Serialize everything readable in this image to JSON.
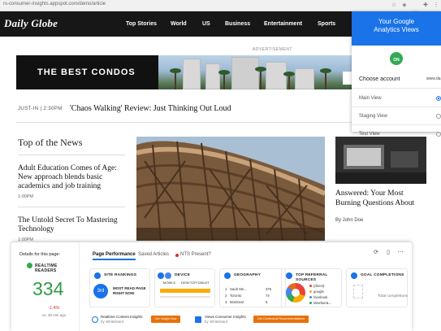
{
  "browser": {
    "url": "rs-consumer-insights.appspot.com/demo/article",
    "icons": [
      "star-icon",
      "extension-icon",
      "analytics-extension-icon",
      "puzzle-icon",
      "menu-icon"
    ]
  },
  "site": {
    "logo": "Daily Globe",
    "nav": [
      "Top Stories",
      "World",
      "US",
      "Business",
      "Entertainment",
      "Sports"
    ]
  },
  "ad": {
    "label": "ADVERTISEMENT",
    "title": "THE BEST CONDOS",
    "cta": "LEAS"
  },
  "ticker": {
    "label": "JUST-IN | 2:30PM",
    "headline": "'Chaos Walking' Review: Just Thinking Out Loud"
  },
  "news": {
    "section": "Top of the News",
    "stories": [
      {
        "title": "Adult Education Comes of Age: New approach blends basic academics and job training",
        "time": "1:00PM"
      },
      {
        "title": "The Untold Secret To Mastering Technology",
        "time": "1:00PM"
      }
    ],
    "side": {
      "title": "Answered: Your Most Burning Questions About",
      "byline": "By John Doe"
    }
  },
  "ga_panel": {
    "title": "Your Google Analytics Views",
    "toggle": "ON",
    "choose_label": "Choose account",
    "selected_account": "www.da",
    "views": [
      {
        "label": "Main View",
        "selected": true
      },
      {
        "label": "Staging View",
        "selected": false
      },
      {
        "label": "Test View",
        "selected": false
      }
    ],
    "accent": "#1a73e8"
  },
  "insights": {
    "details_label": "Details for this page:",
    "realtime": {
      "label": "REALTIME READERS",
      "value": "334",
      "change": "-1.4%",
      "ago": "vs. 30 min ago"
    },
    "tabs": [
      "Page Performance",
      "Saved Articles",
      "NTS Present?"
    ],
    "cards": {
      "site_rankings": {
        "title": "SITE RANKINGS",
        "rank": "3rd",
        "text": "MOST READ PAGE RIGHT NOW"
      },
      "device": {
        "title": "DEVICE",
        "legend": [
          "MOBILE",
          "DESKTOP/TABLET"
        ]
      },
      "geography": {
        "title": "GEOGRAPHY",
        "rows": [
          {
            "n": "1",
            "city": "Sault Ste...",
            "v": "376"
          },
          {
            "n": "2",
            "city": "Toronto",
            "v": "74"
          },
          {
            "n": "3",
            "city": "Montreal",
            "v": "5"
          }
        ]
      },
      "referral": {
        "title": "TOP REFERRAL SOURCES",
        "sources": [
          "(direct)",
          "google",
          "facebook",
          "Member&..."
        ]
      },
      "goals": {
        "title": "GOAL COMPLETIONS",
        "text": "Total completions"
      }
    },
    "bottom": [
      {
        "title": "Realtime Content Insights",
        "sub": "by Whitelisted"
      },
      {
        "title": "Views Consumer Insights",
        "sub": "by Whitelisted"
      }
    ],
    "buttons": [
      "Get Insight Now",
      "Get Contextual Recommendations"
    ],
    "colors": {
      "green": "#2e9c45",
      "red": "#d93025",
      "orange": "#e8710a"
    }
  }
}
